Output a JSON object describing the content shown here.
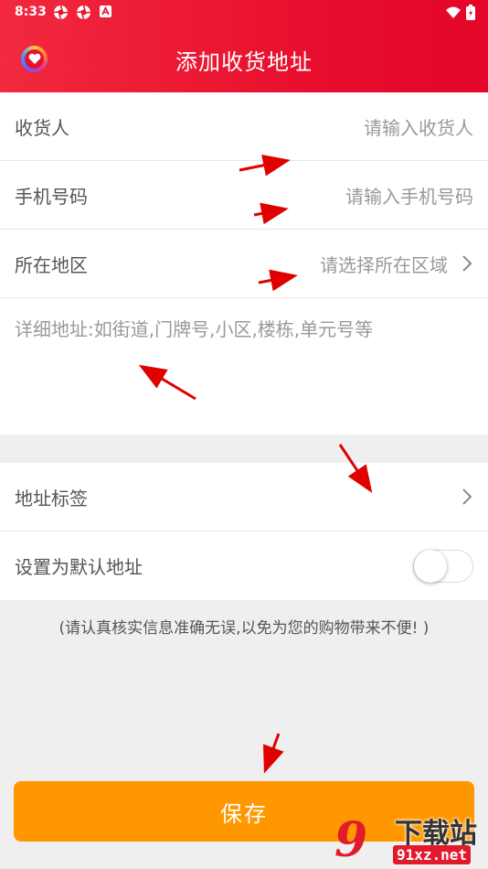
{
  "status_bar": {
    "time": "8:33"
  },
  "header": {
    "title": "添加收货地址"
  },
  "form": {
    "consignee": {
      "label": "收货人",
      "placeholder": "请输入收货人"
    },
    "phone": {
      "label": "手机号码",
      "placeholder": "请输入手机号码"
    },
    "region": {
      "label": "所在地区",
      "placeholder": "请选择所在区域"
    },
    "detail": {
      "placeholder": "详细地址:如街道,门牌号,小区,楼栋,单元号等"
    }
  },
  "options": {
    "tag": {
      "label": "地址标签"
    },
    "default": {
      "label": "设置为默认地址",
      "enabled": false
    }
  },
  "notice": "(请认真核实信息准确无误,以免为您的购物带来不便! )",
  "save_button": "保存",
  "watermark": {
    "logo": "9",
    "name": "下载站",
    "domain": "91xz.net"
  },
  "colors": {
    "header": "#e8102e",
    "save_button": "#ff9800",
    "annotation_arrow": "#e00000"
  }
}
